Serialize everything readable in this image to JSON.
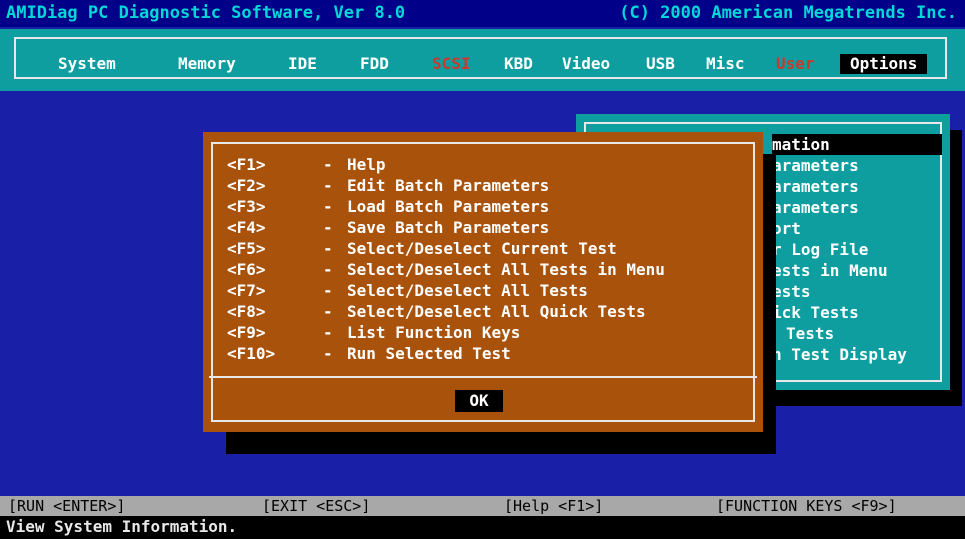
{
  "titlebar": {
    "left": "AMIDiag PC Diagnostic Software, Ver 8.0",
    "right": "(C) 2000 American Megatrends Inc."
  },
  "menu": [
    {
      "label": "System",
      "color": "white"
    },
    {
      "label": "Memory",
      "color": "white"
    },
    {
      "label": "IDE",
      "color": "white"
    },
    {
      "label": "FDD",
      "color": "white"
    },
    {
      "label": "SCSI",
      "color": "red"
    },
    {
      "label": "KBD",
      "color": "white"
    },
    {
      "label": "Video",
      "color": "white"
    },
    {
      "label": "USB",
      "color": "white"
    },
    {
      "label": "Misc",
      "color": "white"
    },
    {
      "label": "User",
      "color": "red"
    },
    {
      "label": "Options",
      "active": true
    }
  ],
  "options_panel": {
    "items": [
      {
        "label": "mation",
        "highlighted": true
      },
      {
        "label": "arameters"
      },
      {
        "label": "arameters"
      },
      {
        "label": "arameters"
      },
      {
        "label": "ort"
      },
      {
        "label": "r Log File"
      },
      {
        "label": "ests in Menu"
      },
      {
        "label": "ests"
      },
      {
        "label": "ick Tests"
      },
      {
        "label": "Tests"
      },
      {
        "label": "n Test Display"
      }
    ]
  },
  "dialog": {
    "keys": [
      {
        "key": "<F1>",
        "dash": "-",
        "desc": "Help"
      },
      {
        "key": "<F2>",
        "dash": "-",
        "desc": "Edit Batch Parameters"
      },
      {
        "key": "<F3>",
        "dash": "-",
        "desc": "Load Batch Parameters"
      },
      {
        "key": "<F4>",
        "dash": "-",
        "desc": "Save Batch Parameters"
      },
      {
        "key": "<F5>",
        "dash": "-",
        "desc": "Select/Deselect Current Test"
      },
      {
        "key": "<F6>",
        "dash": "-",
        "desc": "Select/Deselect All Tests in Menu"
      },
      {
        "key": "<F7>",
        "dash": "-",
        "desc": "Select/Deselect All Tests"
      },
      {
        "key": "<F8>",
        "dash": "-",
        "desc": "Select/Deselect All Quick Tests"
      },
      {
        "key": "<F9>",
        "dash": "-",
        "desc": "List Function Keys"
      },
      {
        "key": "<F10>",
        "dash": "-",
        "desc": "Run Selected Test"
      }
    ],
    "ok_label": "OK"
  },
  "statusbar": {
    "run": "[RUN <ENTER>]",
    "exit": "[EXIT <ESC>]",
    "help": "[Help <F1>]",
    "fkeys": "[FUNCTION KEYS <F9>]"
  },
  "hint": "View System Information.",
  "colors": {
    "desktop": "#1a1fa8",
    "menubar": "#0e9ea0",
    "dialog": "#a8520c",
    "accent_red": "#c83a2e",
    "title_text": "#00d8d8"
  }
}
